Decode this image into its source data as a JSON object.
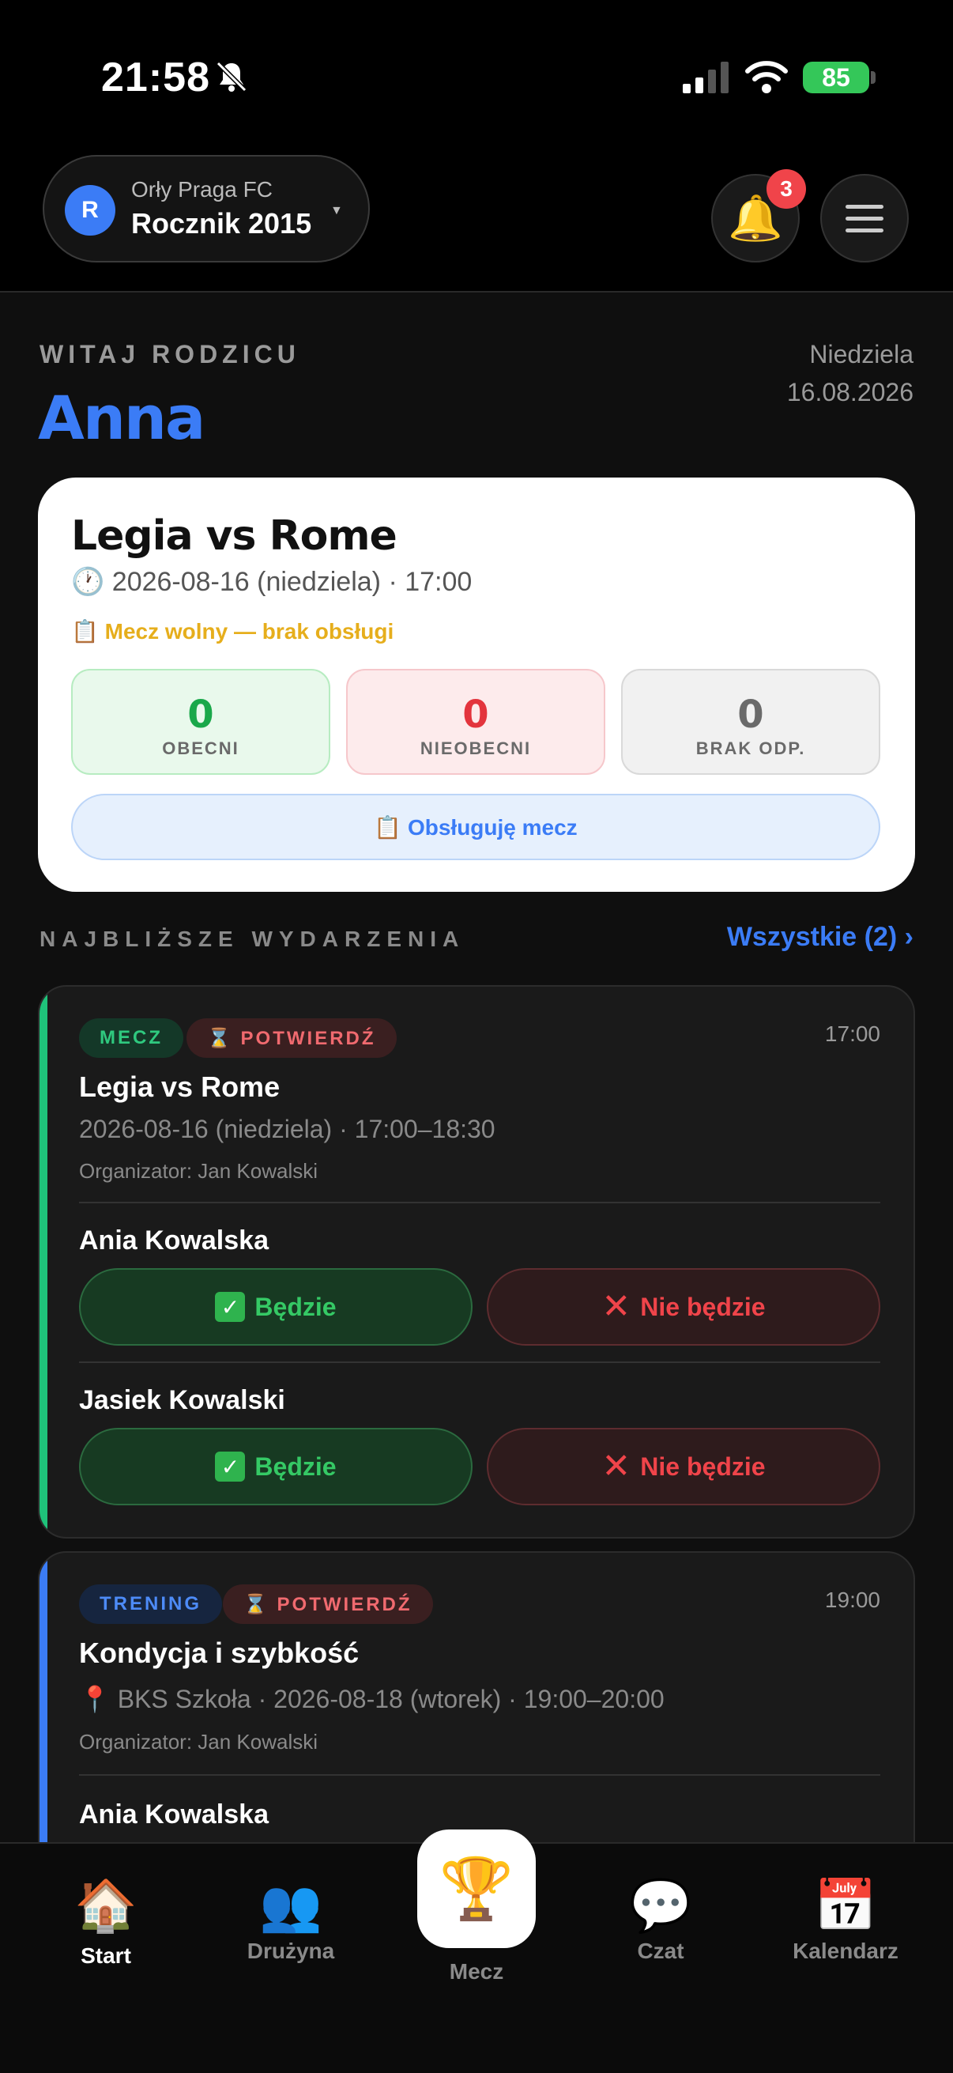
{
  "status": {
    "time": "21:58",
    "battery": "85"
  },
  "header": {
    "club": "Orły Praga FC",
    "year": "Rocznik 2015",
    "avatar_letter": "R",
    "notifications": "3"
  },
  "greeting": {
    "label": "WITAJ RODZICU",
    "name": "Anna",
    "day": "Niedziela",
    "date": "16.08.2026"
  },
  "match": {
    "title": "Legia vs Rome",
    "when": "🕐 2026-08-16 (niedziela) · 17:00",
    "free": "📋 Mecz wolny — brak obsługi",
    "present_count": "0",
    "present_label": "OBECNI",
    "absent_count": "0",
    "absent_label": "NIEOBECNI",
    "none_count": "0",
    "none_label": "BRAK ODP.",
    "handle_button": "📋 Obsługuję mecz"
  },
  "upcoming": {
    "title": "NAJBLIŻSZE WYDARZENIA",
    "all_link": "Wszystkie (2) ›"
  },
  "events": [
    {
      "type_badge": "MECZ",
      "confirm_badge": "⌛ POTWIERDŹ",
      "time": "17:00",
      "title": "Legia vs Rome",
      "when": "2026-08-16 (niedziela) · 17:00–18:30",
      "organizer": "Organizator: Jan Kowalski",
      "children": [
        {
          "name": "Ania Kowalska",
          "yes": "Będzie",
          "no": "Nie będzie"
        },
        {
          "name": "Jasiek Kowalski",
          "yes": "Będzie",
          "no": "Nie będzie"
        }
      ]
    },
    {
      "type_badge": "TRENING",
      "confirm_badge": "⌛ POTWIERDŹ",
      "time": "19:00",
      "title": "Kondycja i szybkość",
      "when": "📍 BKS Szkoła  · 2026-08-18 (wtorek) · 19:00–20:00",
      "organizer": "Organizator: Jan Kowalski",
      "children": [
        {
          "name": "Ania Kowalska"
        }
      ]
    }
  ],
  "nav": {
    "start": "Start",
    "team": "Drużyna",
    "match": "Mecz",
    "chat": "Czat",
    "calendar": "Kalendarz"
  },
  "colors": {
    "accent_blue": "#3b7cf6",
    "match_green": "#1fc27a",
    "danger_red": "#f0444a"
  }
}
